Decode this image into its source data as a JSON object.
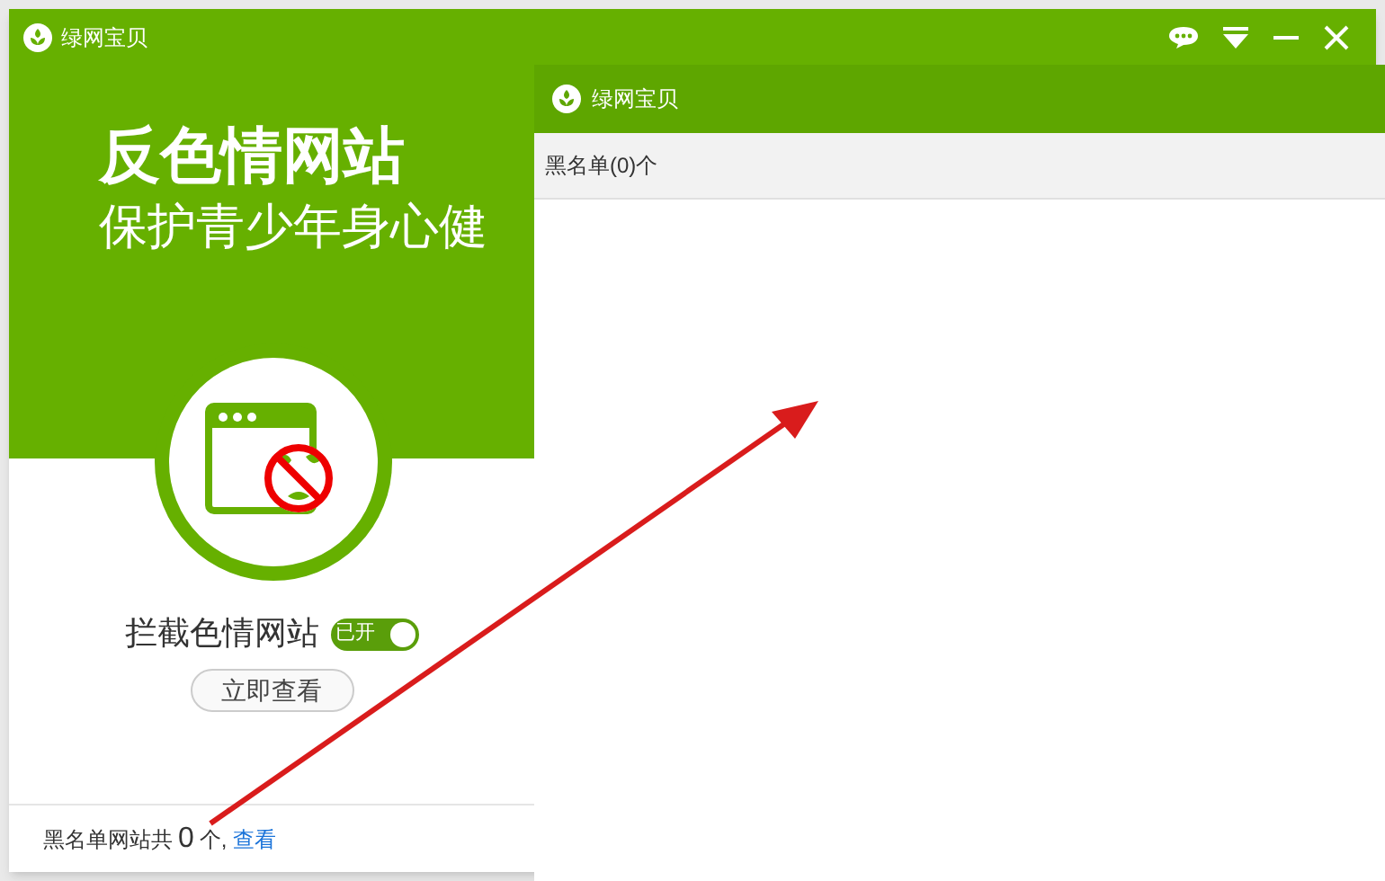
{
  "main_window": {
    "title": "绿网宝贝",
    "headline": "反色情网站",
    "subheadline": "保护青少年身心健",
    "feature": {
      "label": "拦截色情网站",
      "toggle": {
        "label": "已开",
        "on": true
      },
      "button": "立即查看"
    },
    "footer": {
      "prefix": "黑名单网站共",
      "count": "0",
      "suffix": "个,",
      "link": "查看"
    }
  },
  "dialog": {
    "title": "绿网宝贝",
    "header": "黑名单(0)个"
  }
}
